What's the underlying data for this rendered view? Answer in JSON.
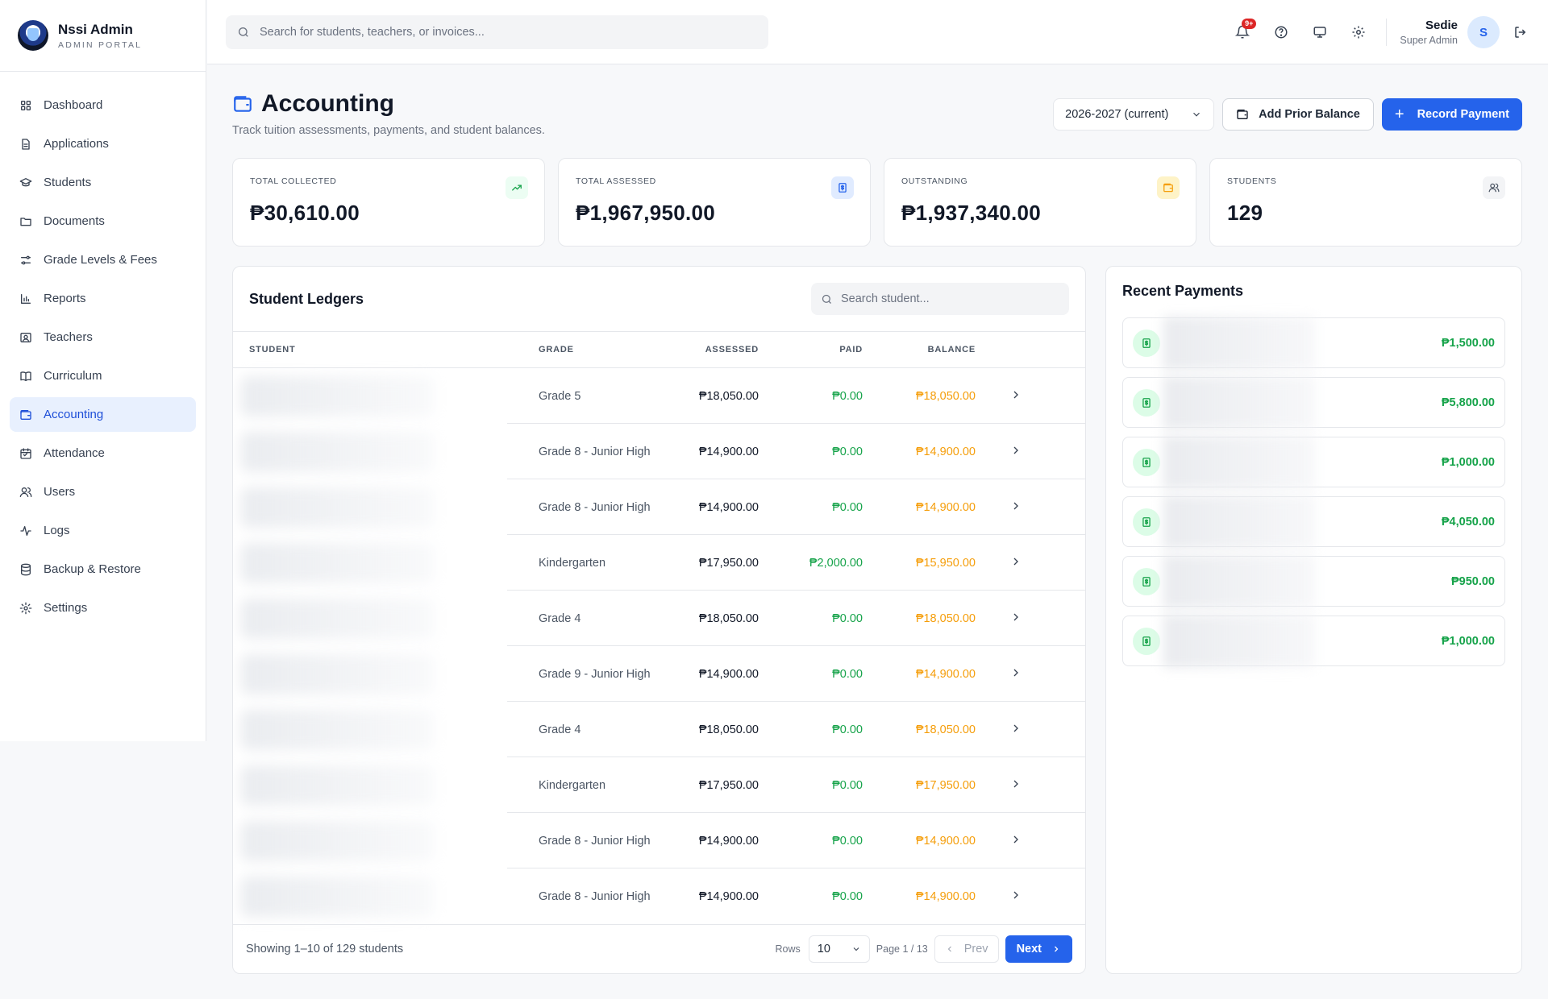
{
  "brand": {
    "title": "Nssi Admin",
    "subtitle": "ADMIN PORTAL"
  },
  "sidebar": {
    "items": [
      {
        "label": "Dashboard",
        "icon": "grid-icon"
      },
      {
        "label": "Applications",
        "icon": "file-icon"
      },
      {
        "label": "Students",
        "icon": "graduation-cap-icon"
      },
      {
        "label": "Documents",
        "icon": "folder-icon"
      },
      {
        "label": "Grade Levels & Fees",
        "icon": "sliders-icon"
      },
      {
        "label": "Reports",
        "icon": "bar-chart-icon"
      },
      {
        "label": "Teachers",
        "icon": "id-card-icon"
      },
      {
        "label": "Curriculum",
        "icon": "book-icon"
      },
      {
        "label": "Accounting",
        "icon": "wallet-icon",
        "active": true
      },
      {
        "label": "Attendance",
        "icon": "calendar-icon"
      },
      {
        "label": "Users",
        "icon": "users-icon"
      },
      {
        "label": "Logs",
        "icon": "activity-icon"
      },
      {
        "label": "Backup & Restore",
        "icon": "database-icon"
      },
      {
        "label": "Settings",
        "icon": "gear-icon"
      }
    ]
  },
  "topbar": {
    "search_placeholder": "Search for students, teachers, or invoices...",
    "notification_badge": "9+",
    "user_name": "Sedie",
    "user_role": "Super Admin",
    "avatar_initial": "S"
  },
  "page": {
    "title": "Accounting",
    "subtitle": "Track tuition assessments, payments, and student balances.",
    "school_year": "2026-2027 (current)",
    "add_prior_balance": "Add Prior Balance",
    "record_payment": "Record Payment"
  },
  "stats": [
    {
      "label": "TOTAL COLLECTED",
      "value": "₱30,610.00",
      "icon": "trending-up-icon",
      "color": "#16a34a",
      "bg": "#ecfdf3"
    },
    {
      "label": "TOTAL ASSESSED",
      "value": "₱1,967,950.00",
      "icon": "receipt-icon",
      "color": "#2563eb",
      "bg": "#e0ebff"
    },
    {
      "label": "OUTSTANDING",
      "value": "₱1,937,340.00",
      "icon": "wallet-icon",
      "color": "#f59e0b",
      "bg": "#fef3c7"
    },
    {
      "label": "STUDENTS",
      "value": "129",
      "icon": "users-icon",
      "color": "#4b5563",
      "bg": "#f3f4f6"
    }
  ],
  "ledger": {
    "title": "Student Ledgers",
    "search_placeholder": "Search student...",
    "columns": {
      "student": "STUDENT",
      "grade": "GRADE",
      "assessed": "ASSESSED",
      "paid": "PAID",
      "balance": "BALANCE"
    },
    "rows": [
      {
        "grade": "Grade 5",
        "assessed": "₱18,050.00",
        "paid": "₱0.00",
        "balance": "₱18,050.00"
      },
      {
        "grade": "Grade 8 - Junior High",
        "assessed": "₱14,900.00",
        "paid": "₱0.00",
        "balance": "₱14,900.00"
      },
      {
        "grade": "Grade 8 - Junior High",
        "assessed": "₱14,900.00",
        "paid": "₱0.00",
        "balance": "₱14,900.00"
      },
      {
        "grade": "Kindergarten",
        "assessed": "₱17,950.00",
        "paid": "₱2,000.00",
        "balance": "₱15,950.00"
      },
      {
        "grade": "Grade 4",
        "assessed": "₱18,050.00",
        "paid": "₱0.00",
        "balance": "₱18,050.00"
      },
      {
        "grade": "Grade 9 - Junior High",
        "assessed": "₱14,900.00",
        "paid": "₱0.00",
        "balance": "₱14,900.00"
      },
      {
        "grade": "Grade 4",
        "assessed": "₱18,050.00",
        "paid": "₱0.00",
        "balance": "₱18,050.00"
      },
      {
        "grade": "Kindergarten",
        "assessed": "₱17,950.00",
        "paid": "₱0.00",
        "balance": "₱17,950.00"
      },
      {
        "grade": "Grade 8 - Junior High",
        "assessed": "₱14,900.00",
        "paid": "₱0.00",
        "balance": "₱14,900.00"
      },
      {
        "grade": "Grade 8 - Junior High",
        "assessed": "₱14,900.00",
        "paid": "₱0.00",
        "balance": "₱14,900.00"
      }
    ],
    "showing": "Showing 1–10 of 129 students",
    "rows_label": "Rows",
    "rows_value": "10",
    "page_info": "Page 1 / 13",
    "prev": "Prev",
    "next": "Next"
  },
  "recent": {
    "title": "Recent Payments",
    "items": [
      {
        "amount": "₱1,500.00"
      },
      {
        "amount": "₱5,800.00"
      },
      {
        "amount": "₱1,000.00"
      },
      {
        "amount": "₱4,050.00"
      },
      {
        "amount": "₱950.00"
      },
      {
        "amount": "₱1,000.00"
      }
    ]
  }
}
